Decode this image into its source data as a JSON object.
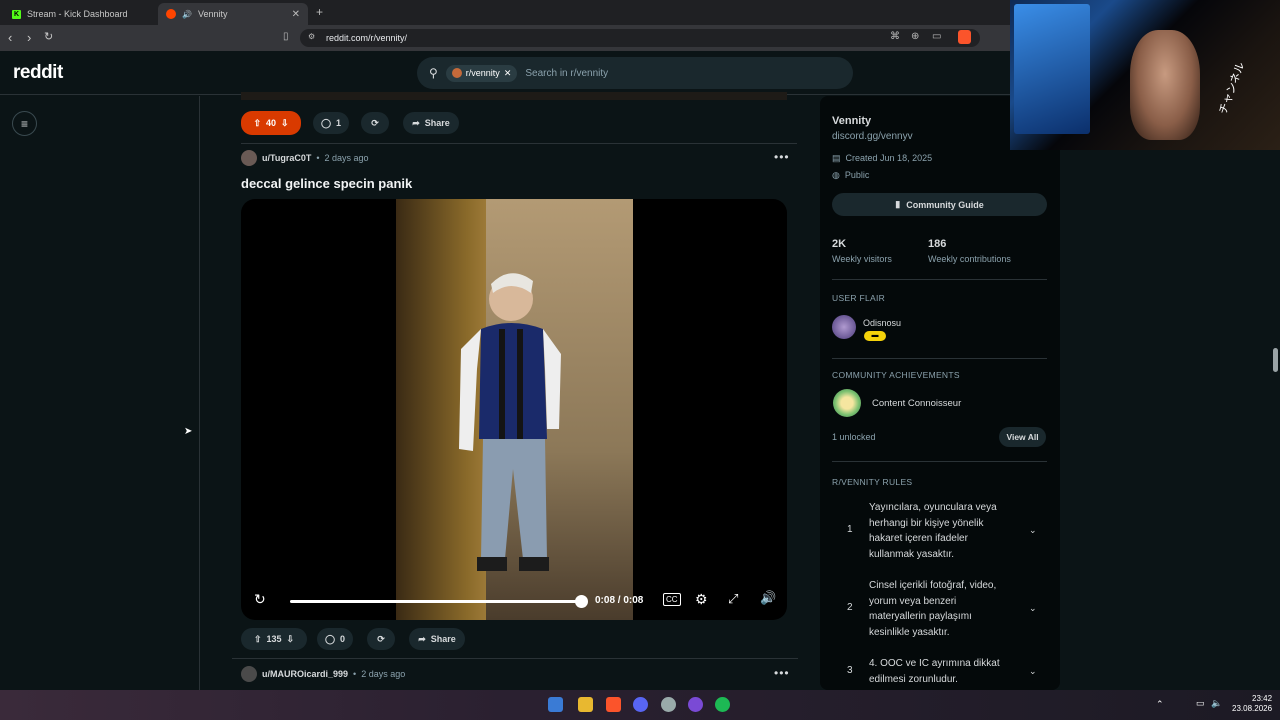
{
  "browser": {
    "tabs": [
      {
        "label": "Stream - Kick Dashboard"
      },
      {
        "label": "Vennity"
      }
    ],
    "url": "reddit.com/r/vennity/"
  },
  "header": {
    "logo": "reddit",
    "search_chip": "r/vennity",
    "search_placeholder": "Search in r/vennity"
  },
  "post_top": {
    "votes": "40",
    "comments": "1",
    "share": "Share"
  },
  "post1": {
    "user": "u/TugraC0T",
    "age": "2 days ago",
    "title": "deccal gelince specin panik",
    "time": "0:08 / 0:08",
    "votes": "135",
    "comments": "0",
    "share": "Share"
  },
  "post2": {
    "user": "u/MAUROicardi_999",
    "age": "2 days ago"
  },
  "sidebar": {
    "name": "Vennity",
    "link": "discord.gg/vennyv",
    "created": "Created Jun 18, 2025",
    "visibility": "Public",
    "guide": "Community Guide",
    "visitors_value": "2K",
    "visitors_label": "Weekly visitors",
    "contrib_value": "186",
    "contrib_label": "Weekly contributions",
    "flair_heading": "USER FLAIR",
    "flair_user": "Odisnosu",
    "achievements_heading": "COMMUNITY ACHIEVEMENTS",
    "achievement": "Content Connoisseur",
    "unlocked": "1 unlocked",
    "view_all": "View All",
    "rules_heading": "R/VENNITY RULES",
    "rules": [
      {
        "num": "1",
        "text": "Yayıncılara, oyunculara veya herhangi bir kişiye yönelik hakaret içeren ifadeler kullanmak yasaktır."
      },
      {
        "num": "2",
        "text": "Cinsel içerikli fotoğraf, video, yorum veya benzeri materyallerin paylaşımı kesinlikle yasaktır."
      },
      {
        "num": "3",
        "text": "4. OOC ve IC ayrımına dikkat edilmesi zorunludur."
      }
    ]
  },
  "taskbar": {
    "time": "23:42",
    "date": "23.08.2026"
  },
  "colors": {
    "accent": "#d93a00",
    "bg": "#0b1416",
    "kick": "#53fc18"
  }
}
